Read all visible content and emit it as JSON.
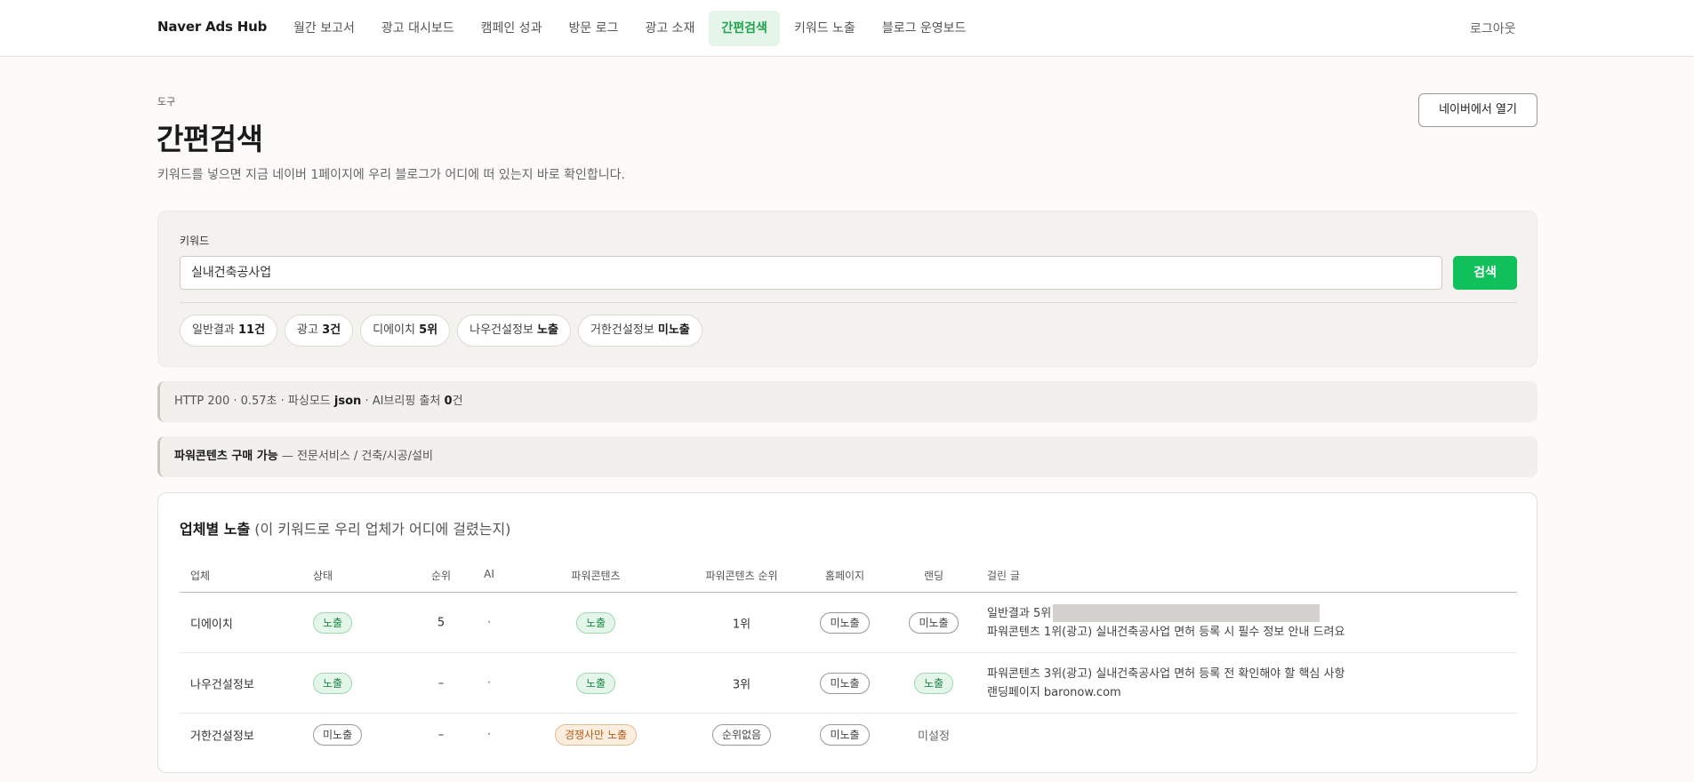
{
  "app": {
    "brand": "Naver Ads Hub",
    "logout_label": "로그아웃"
  },
  "nav": {
    "items": [
      {
        "label": "월간 보고서"
      },
      {
        "label": "광고 대시보드"
      },
      {
        "label": "캠페인 성과"
      },
      {
        "label": "방문 로그"
      },
      {
        "label": "광고 소재"
      },
      {
        "label": "간편검색",
        "active": true
      },
      {
        "label": "키워드 노출"
      },
      {
        "label": "블로그 운영보드"
      }
    ]
  },
  "header": {
    "eyebrow": "도구",
    "title": "간편검색",
    "subtitle": "키워드를 넣으면 지금 네이버 1페이지에 우리 블로그가 어디에 떠 있는지 바로 확인합니다.",
    "open_naver_label": "네이버에서 열기"
  },
  "search": {
    "label": "키워드",
    "value": "실내건축공사업",
    "button_label": "검색",
    "chips": [
      {
        "label": "일반결과",
        "value": "11건"
      },
      {
        "label": "광고",
        "value": "3건"
      },
      {
        "label": "디에이치",
        "value": "5위"
      },
      {
        "label": "나우건설정보",
        "value": "노출"
      },
      {
        "label": "거한건설정보",
        "value": "미노출"
      }
    ]
  },
  "status_bar": {
    "prefix": "HTTP 200 · 0.57초 · 파싱모드",
    "mode": "json",
    "middle": "· AI브리핑 출처",
    "ai_count": "0",
    "suffix": "건"
  },
  "power_content_bar": {
    "strong": "파워콘텐츠 구매 가능",
    "text": "— 전문서비스 / 건축/시공/설비"
  },
  "exposure": {
    "title_strong": "업체별 노출",
    "title_sub": "(이 키워드로 우리 업체가 어디에 걸렸는지)",
    "columns": {
      "name": "업체",
      "status": "상태",
      "rank": "순위",
      "ai": "AI",
      "power_content": "파워콘텐츠",
      "power_content_rank": "파워콘텐츠 순위",
      "homepage": "홈페이지",
      "landing": "랜딩",
      "posts": "걸린 글"
    },
    "rows": [
      {
        "name": "디에이치",
        "status": "노출",
        "rank": "5",
        "ai": "·",
        "power_content": "노출",
        "power_content_rank": "1위",
        "homepage": "미노출",
        "landing": "미노출",
        "post_line1": "일반결과 5위",
        "post_line2": "파워콘텐츠 1위(광고) 실내건축공사업 면허 등록 시 필수 정보 안내 드려요"
      },
      {
        "name": "나우건설정보",
        "status": "노출",
        "rank": "–",
        "ai": "·",
        "power_content": "노출",
        "power_content_rank": "3위",
        "homepage": "미노출",
        "landing": "노출",
        "post_line1": "파워콘텐츠 3위(광고) 실내건축공사업 면허 등록 전 확인해야 할 핵심 사항",
        "post_line2": "랜딩페이지 baronow.com"
      },
      {
        "name": "거한건설정보",
        "status": "미노출",
        "rank": "–",
        "ai": "·",
        "power_content": "경쟁사만 노출",
        "power_content_rank": "순위없음",
        "homepage": "미노출",
        "landing": "미설정"
      }
    ]
  },
  "colors": {
    "accent_green": "#10c15b",
    "active_nav_bg": "#e6f5ea",
    "warn_orange": "#b25e1f"
  }
}
